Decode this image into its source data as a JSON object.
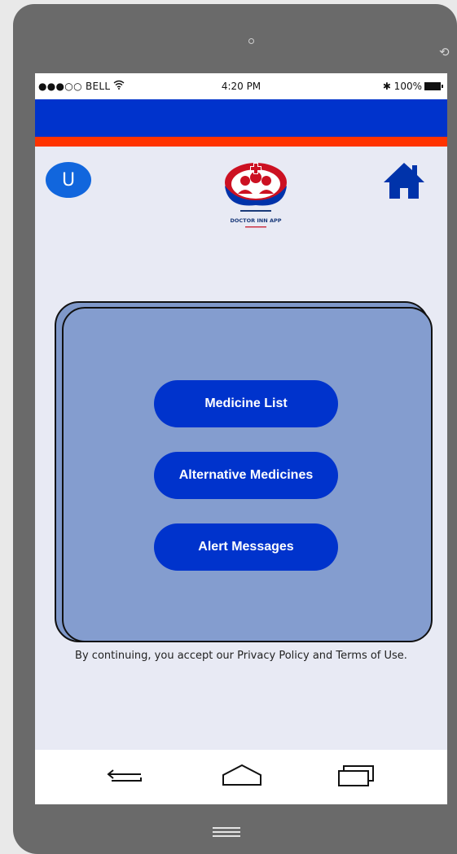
{
  "status_bar": {
    "carrier": "●●●○○ BELL",
    "time": "4:20 PM",
    "battery": "✱ 100%"
  },
  "header": {
    "avatar_letter": "U",
    "logo_caption": "DOCTOR INN APP",
    "icons": {
      "home": "home-icon",
      "avatar": "user-avatar"
    }
  },
  "menu": {
    "items": [
      {
        "label": "Medicine List"
      },
      {
        "label": "Alternative Medicines"
      },
      {
        "label": "Alert Messages"
      }
    ]
  },
  "footer": {
    "legal_text": "By continuing, you accept our Privacy Policy and Terms of Use."
  },
  "colors": {
    "primary": "#0033cc",
    "accent": "#ff3300",
    "card": "#849dcf",
    "background": "#e8eaf4"
  }
}
